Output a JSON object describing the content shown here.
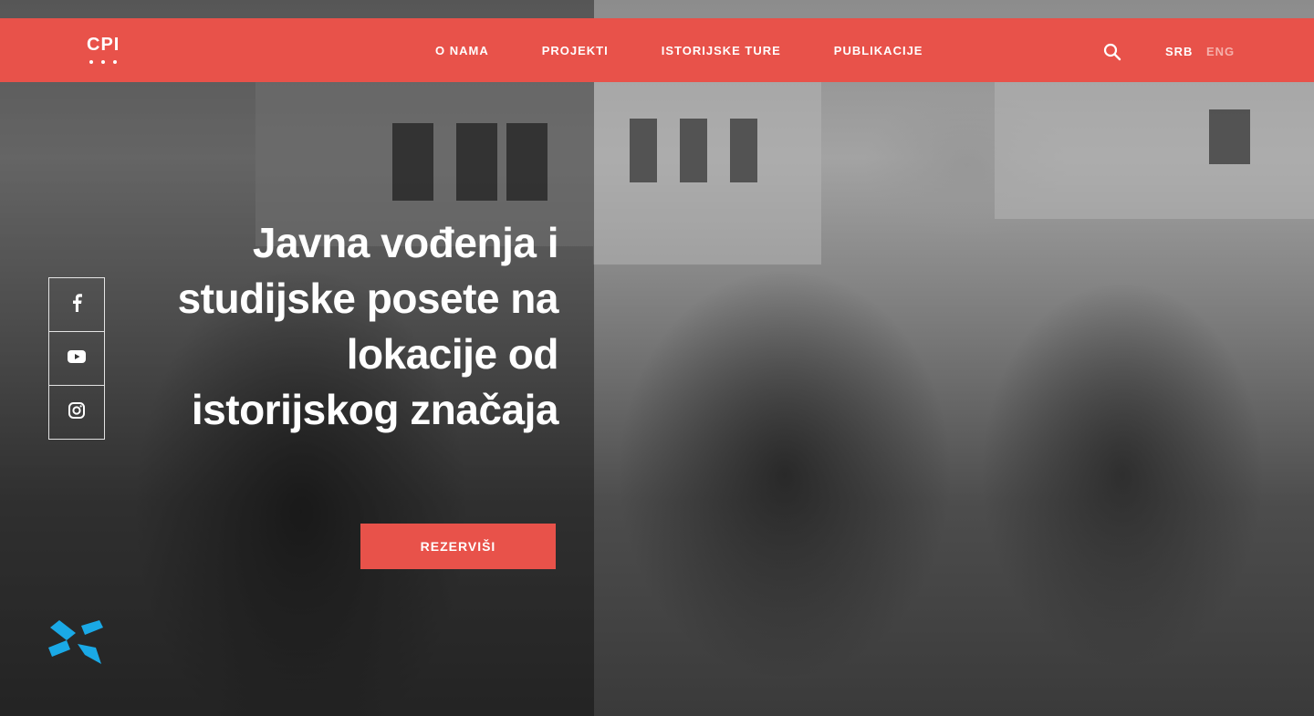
{
  "header": {
    "logo_text": "CPI",
    "nav": [
      "O NAMA",
      "PROJEKTI",
      "ISTORIJSKE TURE",
      "PUBLIKACIJE"
    ],
    "search_icon": "search-icon",
    "languages": {
      "active": "SRB",
      "inactive": "ENG"
    }
  },
  "hero": {
    "title": "Javna vođenja i studijske posete na lokacije od istorijskog značaja",
    "cta_label": "REZERVIŠI"
  },
  "social": [
    "facebook-icon",
    "youtube-icon",
    "instagram-icon"
  ],
  "brand_mark": "brand-mark-icon",
  "colors": {
    "accent": "#e8524a",
    "inactive_lang": "#f5b0ab"
  }
}
